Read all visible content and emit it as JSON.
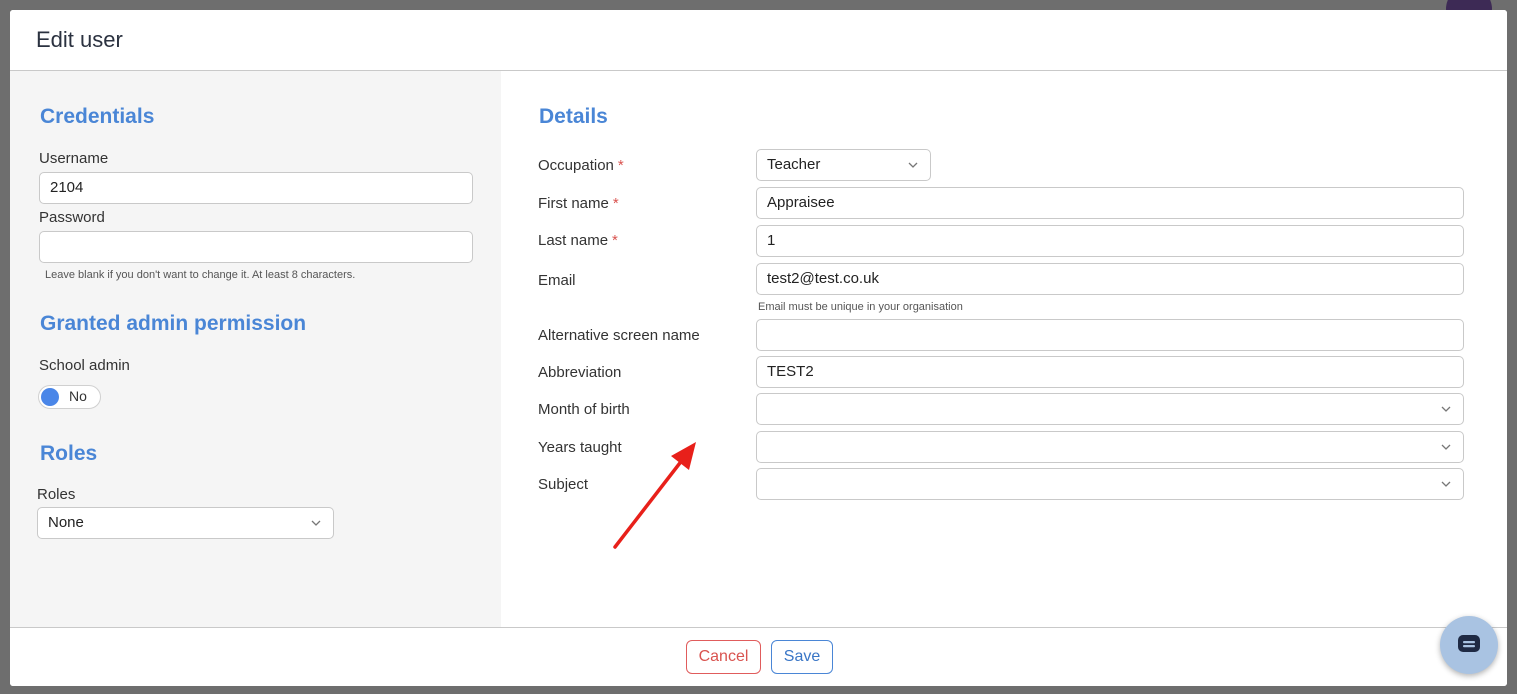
{
  "modal": {
    "title": "Edit user"
  },
  "credentials": {
    "section_title": "Credentials",
    "username_label": "Username",
    "username_value": "2104",
    "password_label": "Password",
    "password_value": "",
    "password_hint": "Leave blank if you don't want to change it. At least 8 characters."
  },
  "admin": {
    "section_title": "Granted admin permission",
    "school_admin_label": "School admin",
    "toggle_text": "No"
  },
  "roles": {
    "section_title": "Roles",
    "label": "Roles",
    "selected": "None"
  },
  "details": {
    "section_title": "Details",
    "required_mark": "*",
    "occupation_label": "Occupation",
    "occupation_value": "Teacher",
    "first_name_label": "First name",
    "first_name_value": "Appraisee",
    "last_name_label": "Last name",
    "last_name_value": "1",
    "email_label": "Email",
    "email_value": "test2@test.co.uk",
    "email_hint": "Email must be unique in your organisation",
    "alt_name_label": "Alternative screen name",
    "alt_name_value": "",
    "abbreviation_label": "Abbreviation",
    "abbreviation_value": "TEST2",
    "month_label": "Month of birth",
    "month_value": "",
    "years_label": "Years taught",
    "years_value": "",
    "subject_label": "Subject",
    "subject_value": ""
  },
  "footer": {
    "cancel_label": "Cancel",
    "save_label": "Save"
  },
  "colors": {
    "accent": "#4a86d6",
    "danger": "#d9534f",
    "annotation_arrow": "#e8201a"
  },
  "icons": {
    "chevron": "chevron-down-icon",
    "chat": "chat-icon"
  }
}
